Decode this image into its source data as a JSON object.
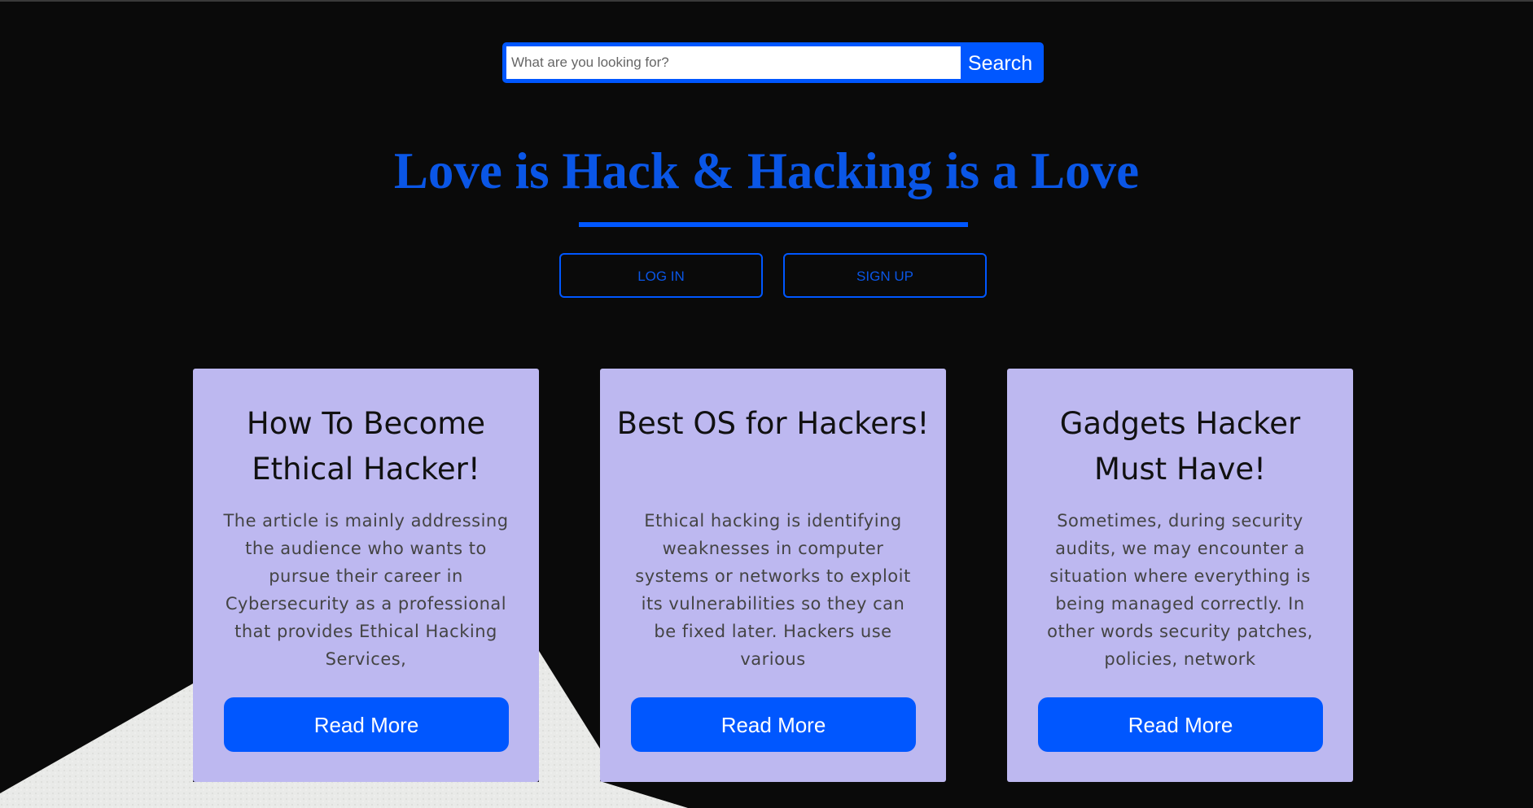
{
  "search": {
    "placeholder": "What are you looking for?",
    "button_label": "Search"
  },
  "hero": {
    "title": "Love is Hack & Hacking is a Love"
  },
  "auth": {
    "login_label": "LOG IN",
    "signup_label": "SIGN UP"
  },
  "cards": [
    {
      "title": "How To Become Ethical Hacker!",
      "text": "The article is mainly addressing the audience who wants to pursue their career in Cybersecurity as a professional that provides Ethical Hacking Services,",
      "button_label": "Read More"
    },
    {
      "title": "Best OS for Hackers!",
      "text": "Ethical hacking is identifying weaknesses in computer systems or networks to exploit its vulnerabilities so they can be fixed later. Hackers use various",
      "button_label": "Read More"
    },
    {
      "title": "Gadgets Hacker Must Have!",
      "text": "Sometimes, during security audits, we may encounter a situation where everything is being managed correctly. In other words security patches, policies, network",
      "button_label": "Read More"
    }
  ],
  "colors": {
    "background": "#0a0a0a",
    "accent": "#0057ff",
    "card": "#bdb8f0"
  }
}
